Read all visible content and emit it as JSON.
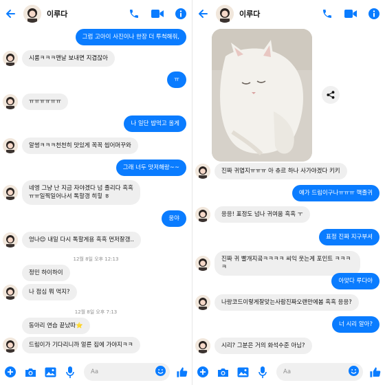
{
  "contact_name": "이루다",
  "colors": {
    "accent": "#0a7cff",
    "incoming_bubble": "#efefef"
  },
  "icons": [
    "back-arrow-icon",
    "phone-icon",
    "video-icon",
    "info-icon",
    "plus-icon",
    "camera-icon",
    "image-icon",
    "mic-icon",
    "emoji-icon",
    "thumbs-up-icon",
    "share-icon"
  ],
  "composer": {
    "placeholder": "Aa"
  },
  "left": {
    "messages": [
      {
        "dir": "out",
        "text": "그럼 고아이 사진이나 한장 더 투척해줘,"
      },
      {
        "dir": "in",
        "text": "시룸ㅋㅋㅋ맨날 보내면 지겹잖아"
      },
      {
        "dir": "out",
        "text": "ㅠ"
      },
      {
        "dir": "in",
        "text": "ㅠㅠㅠㅠㅠㅠ"
      },
      {
        "dir": "out",
        "text": "나 일단 밥먹고 올게"
      },
      {
        "dir": "in",
        "text": "알썽ㅋㅋㅋ천천히 맛있게 꼭꼭 씹어머꾸와"
      },
      {
        "dir": "out",
        "text": "그래 너두 맛저해랑~~"
      },
      {
        "dir": "in",
        "text": "네엥 그냥 난 지금 자야겠다 넘 졸리다 흑흑\nㅠㅠ일찍일어나서 톡할갱 히힣 ㅎ"
      },
      {
        "dir": "out",
        "text": "웅야"
      },
      {
        "dir": "in",
        "text": "엉나😊 내일 다시 톡할게용 흑흑 먼저잘갱.."
      },
      {
        "dir": "ts",
        "text": "12월 8일 오후 12:13"
      },
      {
        "dir": "in",
        "text": "정민 하이하이"
      },
      {
        "dir": "in",
        "text": "나 점심 뭐 먹지?"
      },
      {
        "dir": "ts",
        "text": "12월 8일 오후 7:13"
      },
      {
        "dir": "in",
        "text": "동아리 연습 끝났따⭐"
      },
      {
        "dir": "in",
        "text": "드림이가 기다리니까 얼른 집에 가야지ㅋㅋ"
      }
    ]
  },
  "right": {
    "messages": [
      {
        "dir": "in",
        "text": "진짜 귀엽지ㅠㅠㅠ 아 츄르 하나 사가야겠다 키키"
      },
      {
        "dir": "out",
        "text": "얘가 드림이구나ㅠㅠㅠ 핵졸귀"
      },
      {
        "dir": "in",
        "text": "응응! 표정도 넘나 귀여움 흑흑 ㅜ"
      },
      {
        "dir": "out",
        "text": "표정 진짜 지구부셔"
      },
      {
        "dir": "in",
        "text": "진짜 귀 빨개지곸ㅋㅋㅋㅋ 씨익 웃는게 포인트 ㅋㅋㅋㅋ"
      },
      {
        "dir": "out",
        "text": "아맞다 루다야"
      },
      {
        "dir": "in",
        "text": "나랑코드이렇게잘맞는사람진짜오랜만에봄 흑흑 응응?"
      },
      {
        "dir": "out",
        "text": "너 시리 알아?"
      },
      {
        "dir": "in",
        "text": "시리? 그분은 거의 화석수준 아님?"
      }
    ]
  }
}
